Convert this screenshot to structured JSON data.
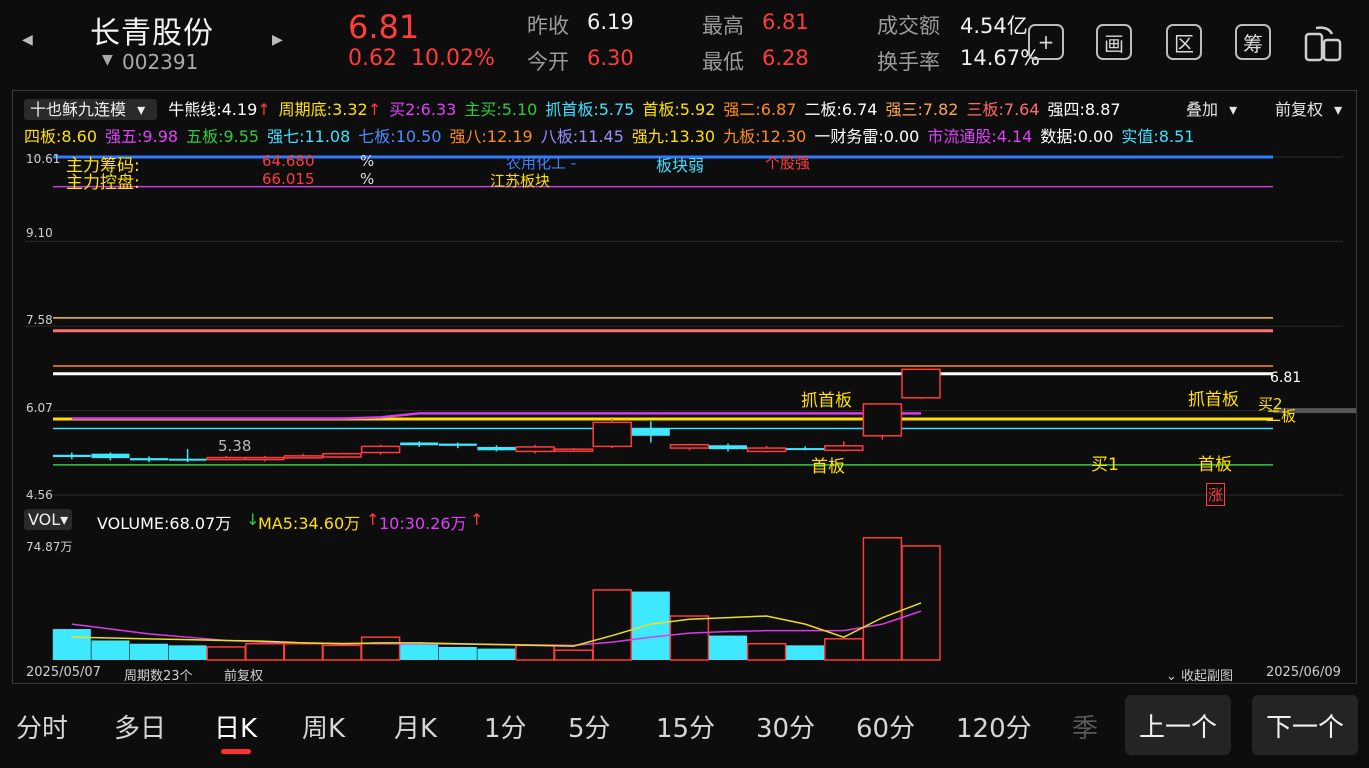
{
  "header": {
    "nav_left": "◀",
    "nav_right": "▶",
    "name": "长青股份",
    "code": "002391",
    "code_arrow": "▼",
    "price": "6.81",
    "change_abs": "0.62",
    "change_pct": "10.02%",
    "stats": {
      "prev_close_label": "昨收",
      "prev_close": "6.19",
      "open_label": "今开",
      "open": "6.30",
      "high_label": "最高",
      "high": "6.81",
      "low_label": "最低",
      "low": "6.28",
      "amount_label": "成交额",
      "amount": "4.54亿",
      "turnover_label": "换手率",
      "turnover": "14.67%"
    },
    "tools": [
      {
        "icon": "plus-box-icon",
        "glyph": "+"
      },
      {
        "icon": "picture-icon",
        "glyph": "画"
      },
      {
        "icon": "region-icon",
        "glyph": "区"
      },
      {
        "icon": "chips-icon",
        "glyph": "筹"
      },
      {
        "icon": "rotate-screen-icon",
        "glyph": "⟳"
      }
    ]
  },
  "indicator": {
    "model": "十也稣九连模",
    "row1": [
      {
        "t": "牛熊线:4.19",
        "c": "#ffffff"
      },
      {
        "t": "↑",
        "c": "#ff3b3b"
      },
      {
        "t": "周期底:3.32",
        "c": "#ffe000"
      },
      {
        "t": "↑",
        "c": "#ff3b3b"
      },
      {
        "t": "买2:6.33",
        "c": "#e040fb"
      },
      {
        "t": "主买:5.10",
        "c": "#2ecc40"
      },
      {
        "t": "抓首板:5.75",
        "c": "#40e0ff"
      },
      {
        "t": "首板:5.92",
        "c": "#ffe000"
      },
      {
        "t": "强二:6.87",
        "c": "#ff8c1a"
      },
      {
        "t": "二板:6.74",
        "c": "#ffffff"
      },
      {
        "t": "强三:7.82",
        "c": "#ffa64d"
      },
      {
        "t": "三板:7.64",
        "c": "#ff6b6b"
      },
      {
        "t": "强四:8.87",
        "c": "#ffffff"
      }
    ],
    "row2": [
      {
        "t": "四板:8.60",
        "c": "#ffe000"
      },
      {
        "t": "强五:9.98",
        "c": "#e040fb"
      },
      {
        "t": "五板:9.55",
        "c": "#2ecc40"
      },
      {
        "t": "强七:11.08",
        "c": "#40e0ff"
      },
      {
        "t": "七板:10.50",
        "c": "#4f8cff"
      },
      {
        "t": "强八:12.19",
        "c": "#ff8c1a"
      },
      {
        "t": "八板:11.45",
        "c": "#9b8cff"
      },
      {
        "t": "强九:13.30",
        "c": "#ffe000"
      },
      {
        "t": "九板:12.30",
        "c": "#ff8c1a"
      },
      {
        "t": "一财务雷:0.00",
        "c": "#ffffff"
      },
      {
        "t": "市流通股:4.14",
        "c": "#e040fb"
      },
      {
        "t": "数据:0.00",
        "c": "#ffffff"
      },
      {
        "t": "实值:8.51",
        "c": "#40e0ff"
      }
    ],
    "overlay_label": "叠加",
    "fq_label": "前复权"
  },
  "chart_data": {
    "type": "candlestick",
    "ylim": [
      4.56,
      10.61
    ],
    "yticks": [
      "10.61",
      "9.10",
      "7.58",
      "6.07",
      "4.56"
    ],
    "candles": [
      {
        "o": 5.28,
        "c": 5.24,
        "h": 5.32,
        "l": 5.2,
        "up": false
      },
      {
        "o": 5.3,
        "c": 5.22,
        "h": 5.32,
        "l": 5.18,
        "up": false
      },
      {
        "o": 5.22,
        "c": 5.18,
        "h": 5.25,
        "l": 5.15,
        "up": false
      },
      {
        "o": 5.21,
        "c": 5.19,
        "h": 5.38,
        "l": 5.15,
        "up": false
      },
      {
        "o": 5.2,
        "c": 5.23,
        "h": 5.26,
        "l": 5.19,
        "up": true
      },
      {
        "o": 5.2,
        "c": 5.23,
        "h": 5.26,
        "l": 5.16,
        "up": true
      },
      {
        "o": 5.26,
        "c": 5.26,
        "h": 5.3,
        "l": 5.24,
        "up": true
      },
      {
        "o": 5.24,
        "c": 5.3,
        "h": 5.32,
        "l": 5.22,
        "up": true
      },
      {
        "o": 5.32,
        "c": 5.43,
        "h": 5.46,
        "l": 5.28,
        "up": true
      },
      {
        "o": 5.5,
        "c": 5.45,
        "h": 5.52,
        "l": 5.42,
        "up": false
      },
      {
        "o": 5.48,
        "c": 5.44,
        "h": 5.5,
        "l": 5.4,
        "up": false
      },
      {
        "o": 5.42,
        "c": 5.36,
        "h": 5.45,
        "l": 5.34,
        "up": false
      },
      {
        "o": 5.34,
        "c": 5.42,
        "h": 5.46,
        "l": 5.3,
        "up": true
      },
      {
        "o": 5.36,
        "c": 5.38,
        "h": 5.4,
        "l": 5.34,
        "up": true
      },
      {
        "o": 5.43,
        "c": 5.86,
        "h": 5.92,
        "l": 5.4,
        "up": true
      },
      {
        "o": 5.75,
        "c": 5.62,
        "h": 5.88,
        "l": 5.5,
        "up": false
      },
      {
        "o": 5.4,
        "c": 5.46,
        "h": 5.48,
        "l": 5.36,
        "up": true
      },
      {
        "o": 5.45,
        "c": 5.38,
        "h": 5.48,
        "l": 5.34,
        "up": false
      },
      {
        "o": 5.34,
        "c": 5.4,
        "h": 5.44,
        "l": 5.32,
        "up": true
      },
      {
        "o": 5.4,
        "c": 5.38,
        "h": 5.43,
        "l": 5.36,
        "up": false
      },
      {
        "o": 5.36,
        "c": 5.44,
        "h": 5.52,
        "l": 5.34,
        "up": true
      },
      {
        "o": 5.62,
        "c": 6.19,
        "h": 6.19,
        "l": 5.55,
        "up": true
      },
      {
        "o": 6.3,
        "c": 6.81,
        "h": 6.81,
        "l": 6.28,
        "up": true
      }
    ],
    "purple_line": [
      5.93,
      5.93,
      5.93,
      5.93,
      5.93,
      5.93,
      5.93,
      5.93,
      5.95,
      6.02,
      6.02,
      6.02,
      6.02,
      6.02,
      6.02,
      6.02,
      6.02,
      6.02,
      6.02,
      6.02,
      6.02,
      6.02,
      6.02
    ],
    "hlines": [
      {
        "v": 10.61,
        "color": "#2f7bff",
        "w": 3
      },
      {
        "v": 10.08,
        "color": "#c040e0",
        "w": 1.5
      },
      {
        "v": 7.73,
        "color": "#ffc040",
        "w": 1.5
      },
      {
        "v": 7.5,
        "color": "#ff7070",
        "w": 3
      },
      {
        "v": 6.87,
        "color": "#ff8c1a",
        "w": 1.5
      },
      {
        "v": 6.73,
        "color": "#ffffff",
        "w": 3
      },
      {
        "v": 5.92,
        "color": "#ffe000",
        "w": 3
      },
      {
        "v": 5.75,
        "color": "#40e0ff",
        "w": 1.5
      },
      {
        "v": 5.1,
        "color": "#2ecc40",
        "w": 1.5
      }
    ],
    "annotations": {
      "low_label": "5.38",
      "last_price": "6.81",
      "zhuli_chouma_label": "主力筹码:",
      "zhuli_chouma_val": "64.680",
      "zhuli_kongpan_label": "主力控盘:",
      "zhuli_kongpan_val": "66.015",
      "pct1": "%",
      "pct2": "%",
      "sector1": "农用化工 -",
      "sector_weak": "板块弱",
      "stock_strong": "个股强",
      "sector2": "江苏板块",
      "zhua1": "抓首板",
      "shou1": "首板",
      "zhua2": "抓首板",
      "shou2": "首板",
      "mai1": "买1",
      "mai2": "买2",
      "erban": "二板",
      "zhang": "涨"
    },
    "volume": {
      "label": "VOL",
      "volume_text": "VOLUME:68.07万",
      "ma5_text": "MA5:34.60万",
      "ma10_text": "10:30.26万",
      "max_label": "74.87万",
      "ymax": 74.87,
      "bars": [
        19,
        12,
        10,
        9,
        8,
        10,
        10,
        9,
        14,
        10,
        8,
        7,
        9,
        6,
        43,
        42,
        27,
        15,
        10,
        9,
        13,
        75,
        70
      ],
      "ma5": [
        14,
        13.5,
        13,
        12.5,
        12,
        11.5,
        10.5,
        10,
        10.5,
        10.5,
        10,
        9.5,
        9,
        8.5,
        15,
        22,
        25,
        26,
        27,
        22,
        14,
        26,
        35
      ],
      "ma10": [
        22,
        19,
        16,
        14,
        12,
        11,
        10.5,
        10.2,
        10,
        10,
        9.8,
        9.5,
        9.3,
        9,
        11,
        14,
        16.5,
        17.5,
        18,
        18,
        18,
        22,
        30
      ]
    },
    "date_start": "2025/05/07",
    "period_count": "周期数23个",
    "fq_bottom": "前复权",
    "collapse": "收起副图",
    "date_end": "2025/06/09"
  },
  "tabs": [
    "分时",
    "多日",
    "日K",
    "周K",
    "月K",
    "1分",
    "5分",
    "15分",
    "30分",
    "60分",
    "120分",
    "季"
  ],
  "active_tab": "日K",
  "prev_btn": "上一个",
  "next_btn": "下一个"
}
